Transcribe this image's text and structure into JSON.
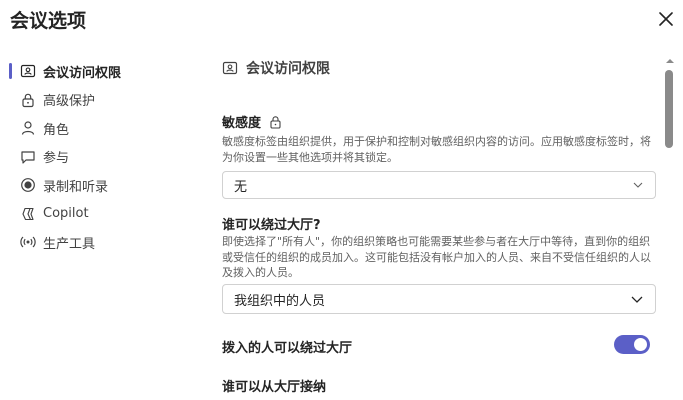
{
  "dialog": {
    "title": "会议选项"
  },
  "sidebar": {
    "items": [
      {
        "label": "会议访问权限",
        "icon": "person-card-icon",
        "active": true
      },
      {
        "label": "高级保护",
        "icon": "lock-icon"
      },
      {
        "label": "角色",
        "icon": "person-icon"
      },
      {
        "label": "参与",
        "icon": "chat-icon"
      },
      {
        "label": "录制和听录",
        "icon": "record-icon"
      },
      {
        "label": "Copilot",
        "icon": "copilot-icon"
      },
      {
        "label": "生产工具",
        "icon": "broadcast-icon"
      }
    ]
  },
  "main": {
    "section_title": "会议访问权限",
    "sensitivity": {
      "label": "敏感度",
      "description": "敏感度标签由组织提供，用于保护和控制对敏感组织内容的访问。应用敏感度标签时，将为你设置一些其他选项并将其锁定。",
      "value": "无"
    },
    "bypass_lobby": {
      "label": "谁可以绕过大厅?",
      "description": "即使选择了\"所有人\"，你的组织策略也可能需要某些参与者在大厅中等待，直到你的组织或受信任的组织的成员加入。这可能包括没有帐户加入的人员、来自不受信任组织的人以及拨入的人员。",
      "value": "我组织中的人员"
    },
    "dial_in_bypass": {
      "label": "拨入的人可以绕过大厅",
      "enabled": true
    },
    "admit_from_lobby": {
      "label": "谁可以从大厅接纳"
    }
  },
  "colors": {
    "accent": "#5b5fc7"
  }
}
